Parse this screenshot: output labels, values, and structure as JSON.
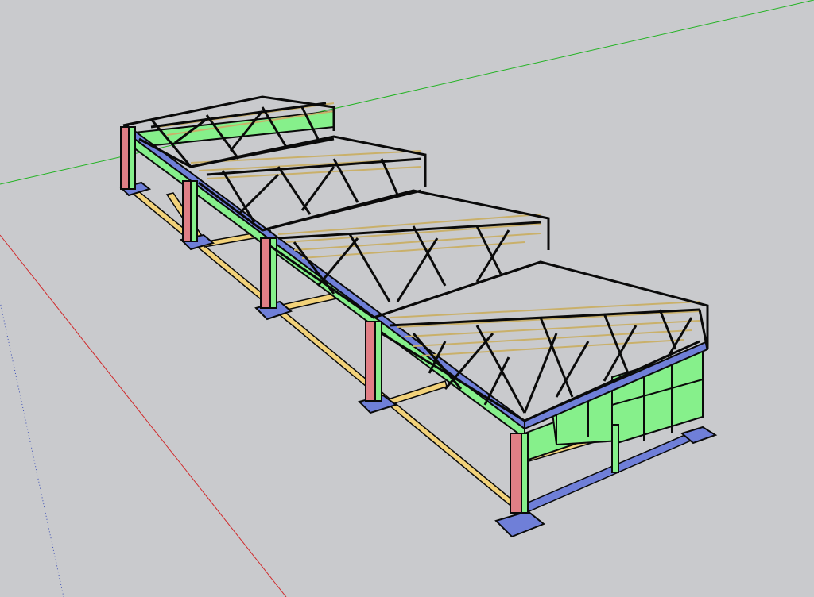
{
  "viewport": {
    "background": "#c9cacd"
  },
  "axes": {
    "x_axis_color": "#d0282a",
    "y_axis_color": "#22b322",
    "z_axis_dotted_color": "#3a4db5"
  },
  "model": {
    "colors": {
      "truss": "#0a0a0a",
      "purlin": "#c9b06a",
      "tie_beam": "#f2d27a",
      "footing": "#6f7fd8",
      "column": "#e07f86",
      "wall_panel": "#86f08b",
      "eave_beam": "#6f7fd8"
    },
    "bays": 4
  }
}
